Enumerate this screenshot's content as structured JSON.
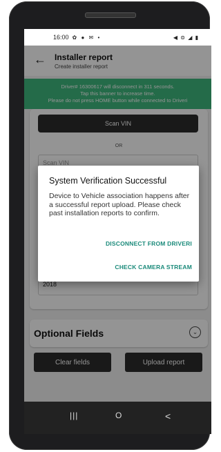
{
  "status_bar": {
    "time": "16:00",
    "left_icons": "✿ ● ✉ •",
    "right_icons": "◀ ⊜ ◢ ▮"
  },
  "app_bar": {
    "back_icon": "←",
    "title": "Installer report",
    "subtitle": "Create installer report"
  },
  "banner": {
    "line1": "Driver# 16300617 will disconnect in 311 seconds.",
    "line2": "Tap this banner to increase time.",
    "line3": "Please do not press HOME button while connected to Driveri"
  },
  "form": {
    "scan_vin_label": "Scan VIN",
    "or_label": "OR",
    "vin_placeholder": "Scan VIN",
    "year_value": "2018"
  },
  "optional": {
    "label": "Optional Fields",
    "chevron_icon": "⌄"
  },
  "actions": {
    "clear_label": "Clear fields",
    "upload_label": "Upload report"
  },
  "nav": {
    "recents_icon": "|||",
    "home_icon": "O",
    "back_icon": "<"
  },
  "dialog": {
    "title": "System Verification Successful",
    "body": "Device to Vehicle association happens after a successful report upload. Please check past installation reports to confirm.",
    "disconnect_label": "DISCONNECT FROM DRIVERI",
    "camera_label": "CHECK CAMERA STREAM"
  },
  "colors": {
    "banner": "#3fb87e",
    "dialog_action": "#1a8a7a",
    "button": "#2b2b2b"
  }
}
